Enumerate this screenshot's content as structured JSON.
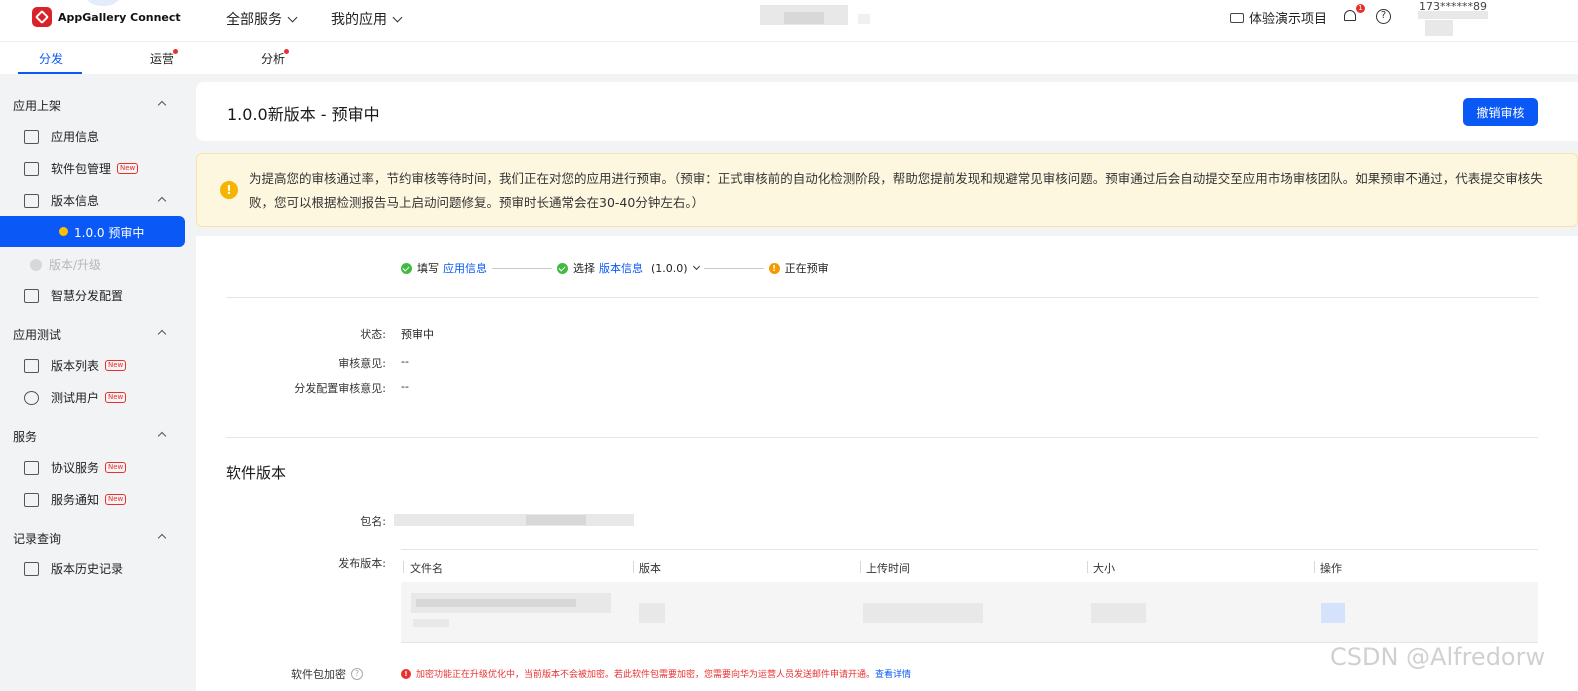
{
  "header": {
    "brand": "AppGallery Connect",
    "nav_all_services": "全部服务",
    "nav_my_apps": "我的应用",
    "demo_project": "体验演示项目",
    "notification_count": "1",
    "help_symbol": "?",
    "account": "173******89"
  },
  "tabs": [
    {
      "label": "分发",
      "active": true
    },
    {
      "label": "运营",
      "has_dot": true
    },
    {
      "label": "分析",
      "has_dot": true
    }
  ],
  "sidebar": {
    "groups": [
      {
        "title": "应用上架",
        "items": [
          "应用信息",
          "软件包管理",
          "版本信息",
          "1.0.0 预审中",
          "版本/升级",
          "智慧分发配置"
        ]
      },
      {
        "title": "应用测试",
        "items": [
          "版本列表",
          "测试用户"
        ]
      },
      {
        "title": "服务",
        "items": [
          "协议服务",
          "服务通知"
        ]
      },
      {
        "title": "记录查询",
        "items": [
          "版本历史记录"
        ]
      }
    ],
    "new_tag": "New"
  },
  "page": {
    "title": "1.0.0新版本 - 预审中",
    "revoke_button": "撤销审核"
  },
  "notice": {
    "text": "为提高您的审核通过率，节约审核等待时间，我们正在对您的应用进行预审。（预审：正式审核前的自动化检测阶段，帮助您提前发现和规避常见审核问题。预审通过后会自动提交至应用市场审核团队。如果预审不通过，代表提交审核失败，您可以根据检测报告马上启动问题修复。预审时长通常会在30-40分钟左右。）"
  },
  "steps": {
    "step1_prefix": "填写",
    "step1_link": "应用信息",
    "step2_prefix": "选择",
    "step2_link": "版本信息",
    "step2_version": "(1.0.0)",
    "step3": "正在预审"
  },
  "status": {
    "status_label": "状态:",
    "status_value": "预审中",
    "review_label": "审核意见:",
    "review_value": "--",
    "dist_label": "分发配置审核意见:",
    "dist_value": "--"
  },
  "software": {
    "section_title": "软件版本",
    "package_label": "包名:",
    "release_label": "发布版本:",
    "columns": [
      "文件名",
      "版本",
      "上传时间",
      "大小",
      "操作"
    ],
    "encrypt_label": "软件包加密",
    "encrypt_msg": "加密功能正在升级优化中，当前版本不会被加密。若此软件包需要加密，您需要向华为运营人员发送邮件申请开通。",
    "encrypt_link": "查看详情"
  },
  "watermark": "CSDN @Alfredorw"
}
